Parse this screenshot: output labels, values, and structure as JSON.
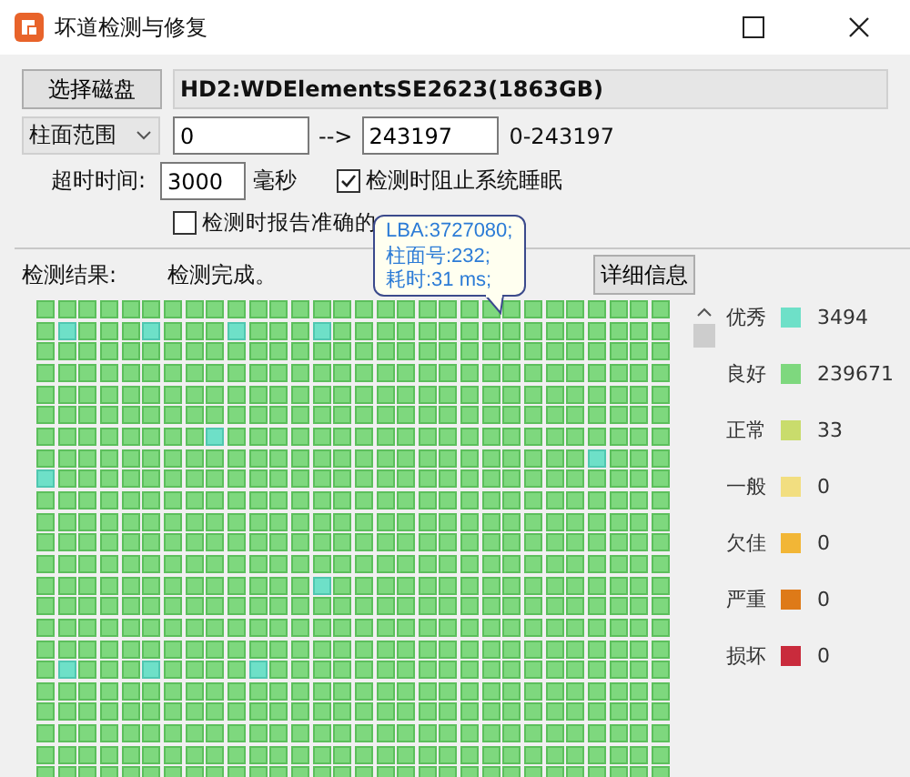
{
  "window": {
    "title": "坏道检测与修复"
  },
  "disk_button": "选择磁盘",
  "disk_name": "HD2:WDElementsSE2623(1863GB)",
  "range": {
    "mode": "柱面范围",
    "from": "0",
    "arrow": "-->",
    "to": "243197",
    "span": "0-243197"
  },
  "timeout": {
    "label": "超时时间:",
    "value": "3000",
    "unit": "毫秒"
  },
  "options": [
    {
      "label": "检测时阻止系统睡眠",
      "checked": true
    },
    {
      "label": "检测时报告准确的",
      "checked": false
    }
  ],
  "result": {
    "label": "检测结果:",
    "status": "检测完成。",
    "details_button": "详细信息"
  },
  "tooltip": {
    "lines": [
      "LBA:3727080;",
      "柱面号:232;",
      "耗时:31 ms;"
    ]
  },
  "grid": {
    "rows": [
      {
        "excellent": [
          false,
          false,
          false,
          false,
          false,
          false,
          false,
          false,
          false,
          false,
          false,
          false,
          false,
          false,
          false,
          false,
          false,
          false,
          false,
          false,
          false,
          false,
          false,
          false,
          false,
          false,
          false,
          false,
          false,
          false
        ]
      },
      {
        "excellent": [
          false,
          true,
          false,
          false,
          false,
          true,
          false,
          false,
          false,
          true,
          false,
          false,
          false,
          true,
          false,
          false,
          false,
          false,
          false,
          false,
          false,
          false,
          false,
          false,
          false,
          false,
          false,
          false,
          false,
          false
        ]
      },
      {
        "excellent": [
          false,
          false,
          false,
          false,
          false,
          false,
          false,
          false,
          false,
          false,
          false,
          false,
          false,
          false,
          false,
          false,
          false,
          false,
          false,
          false,
          false,
          false,
          false,
          false,
          false,
          false,
          false,
          false,
          false,
          false
        ]
      },
      {
        "excellent": [
          false,
          false,
          false,
          false,
          false,
          false,
          false,
          false,
          false,
          false,
          false,
          false,
          false,
          false,
          false,
          false,
          false,
          false,
          false,
          false,
          false,
          false,
          false,
          false,
          false,
          false,
          false,
          false,
          false,
          false
        ]
      },
      {
        "excellent": [
          false,
          false,
          false,
          false,
          false,
          false,
          false,
          false,
          false,
          false,
          false,
          false,
          false,
          false,
          false,
          false,
          false,
          false,
          false,
          false,
          false,
          false,
          false,
          false,
          false,
          false,
          false,
          false,
          false,
          false
        ]
      },
      {
        "excellent": [
          false,
          false,
          false,
          false,
          false,
          false,
          false,
          false,
          false,
          false,
          false,
          false,
          false,
          false,
          false,
          false,
          false,
          false,
          false,
          false,
          false,
          false,
          false,
          false,
          false,
          false,
          false,
          false,
          false,
          false
        ]
      },
      {
        "excellent": [
          false,
          false,
          false,
          false,
          false,
          false,
          false,
          false,
          true,
          false,
          false,
          false,
          false,
          false,
          false,
          false,
          false,
          false,
          false,
          false,
          false,
          false,
          false,
          false,
          false,
          false,
          false,
          false,
          false,
          false
        ]
      },
      {
        "excellent": [
          false,
          false,
          false,
          false,
          false,
          false,
          false,
          false,
          false,
          false,
          false,
          false,
          false,
          false,
          false,
          false,
          false,
          false,
          false,
          false,
          false,
          false,
          false,
          false,
          false,
          false,
          true,
          false,
          false,
          false
        ]
      },
      {
        "excellent": [
          true,
          false,
          false,
          false,
          false,
          false,
          false,
          false,
          false,
          false,
          false,
          false,
          false,
          false,
          false,
          false,
          false,
          false,
          false,
          false,
          false,
          false,
          false,
          false,
          false,
          false,
          false,
          false,
          false,
          false
        ]
      },
      {
        "excellent": [
          false,
          false,
          false,
          false,
          false,
          false,
          false,
          false,
          false,
          false,
          false,
          false,
          false,
          false,
          false,
          false,
          false,
          false,
          false,
          false,
          false,
          false,
          false,
          false,
          false,
          false,
          false,
          false,
          false,
          false
        ]
      },
      {
        "excellent": [
          false,
          false,
          false,
          false,
          false,
          false,
          false,
          false,
          false,
          false,
          false,
          false,
          false,
          false,
          false,
          false,
          false,
          false,
          false,
          false,
          false,
          false,
          false,
          false,
          false,
          false,
          false,
          false,
          false,
          false
        ]
      },
      {
        "excellent": [
          false,
          false,
          false,
          false,
          false,
          false,
          false,
          false,
          false,
          false,
          false,
          false,
          false,
          false,
          false,
          false,
          false,
          false,
          false,
          false,
          false,
          false,
          false,
          false,
          false,
          false,
          false,
          false,
          false,
          false
        ]
      },
      {
        "excellent": [
          false,
          false,
          false,
          false,
          false,
          false,
          false,
          false,
          false,
          false,
          false,
          false,
          false,
          false,
          false,
          false,
          false,
          false,
          false,
          false,
          false,
          false,
          false,
          false,
          false,
          false,
          false,
          false,
          false,
          false
        ]
      },
      {
        "excellent": [
          false,
          false,
          false,
          false,
          false,
          false,
          false,
          false,
          false,
          false,
          false,
          false,
          false,
          true,
          false,
          false,
          false,
          false,
          false,
          false,
          false,
          false,
          false,
          false,
          false,
          false,
          false,
          false,
          false,
          false
        ]
      },
      {
        "excellent": [
          false,
          false,
          false,
          false,
          false,
          false,
          false,
          false,
          false,
          false,
          false,
          false,
          false,
          false,
          false,
          false,
          false,
          false,
          false,
          false,
          false,
          false,
          false,
          false,
          false,
          false,
          false,
          false,
          false,
          false
        ]
      },
      {
        "excellent": [
          false,
          false,
          false,
          false,
          false,
          false,
          false,
          false,
          false,
          false,
          false,
          false,
          false,
          false,
          false,
          false,
          false,
          false,
          false,
          false,
          false,
          false,
          false,
          false,
          false,
          false,
          false,
          false,
          false,
          false
        ]
      },
      {
        "excellent": [
          false,
          false,
          false,
          false,
          false,
          false,
          false,
          false,
          false,
          false,
          false,
          false,
          false,
          false,
          false,
          false,
          false,
          false,
          false,
          false,
          false,
          false,
          false,
          false,
          false,
          false,
          false,
          false,
          false,
          false
        ]
      },
      {
        "excellent": [
          false,
          true,
          false,
          false,
          false,
          true,
          false,
          false,
          false,
          false,
          true,
          false,
          false,
          false,
          false,
          false,
          false,
          false,
          false,
          false,
          false,
          false,
          false,
          false,
          false,
          false,
          false,
          false,
          false,
          false
        ]
      },
      {
        "excellent": [
          false,
          false,
          false,
          false,
          false,
          false,
          false,
          false,
          false,
          false,
          false,
          false,
          false,
          false,
          false,
          false,
          false,
          false,
          false,
          false,
          false,
          false,
          false,
          false,
          false,
          false,
          false,
          false,
          false,
          false
        ]
      },
      {
        "excellent": [
          false,
          false,
          false,
          false,
          false,
          false,
          false,
          false,
          false,
          false,
          false,
          false,
          false,
          false,
          false,
          false,
          false,
          false,
          false,
          false,
          false,
          false,
          false,
          false,
          false,
          false,
          false,
          false,
          false,
          false
        ]
      },
      {
        "excellent": [
          false,
          false,
          false,
          false,
          false,
          false,
          false,
          false,
          false,
          false,
          false,
          false,
          false,
          false,
          false,
          false,
          false,
          false,
          false,
          false,
          false,
          false,
          false,
          false,
          false,
          false,
          false,
          false,
          false,
          false
        ]
      },
      {
        "excellent": [
          false,
          false,
          false,
          false,
          false,
          false,
          false,
          false,
          false,
          false,
          false,
          false,
          false,
          false,
          false,
          false,
          false,
          false,
          false,
          false,
          false,
          false,
          false,
          false,
          false,
          false,
          false,
          false,
          false,
          false
        ]
      },
      {
        "excellent": [
          false,
          false,
          false,
          false,
          false,
          false,
          false,
          false,
          false,
          false,
          false,
          false,
          false,
          false,
          false,
          false,
          false,
          false,
          false,
          false,
          false,
          false,
          false,
          false,
          false,
          false,
          false,
          false,
          false,
          false
        ]
      }
    ]
  },
  "legend": [
    {
      "label": "优秀",
      "color": "#6ee0c8",
      "count": "3494"
    },
    {
      "label": "良好",
      "color": "#7ed87e",
      "count": "239671"
    },
    {
      "label": "正常",
      "color": "#c9dc6c",
      "count": "33"
    },
    {
      "label": "一般",
      "color": "#f2de80",
      "count": "0"
    },
    {
      "label": "欠佳",
      "color": "#f2b636",
      "count": "0"
    },
    {
      "label": "严重",
      "color": "#de7a18",
      "count": "0"
    },
    {
      "label": "损坏",
      "color": "#c92b3c",
      "count": "0"
    }
  ]
}
